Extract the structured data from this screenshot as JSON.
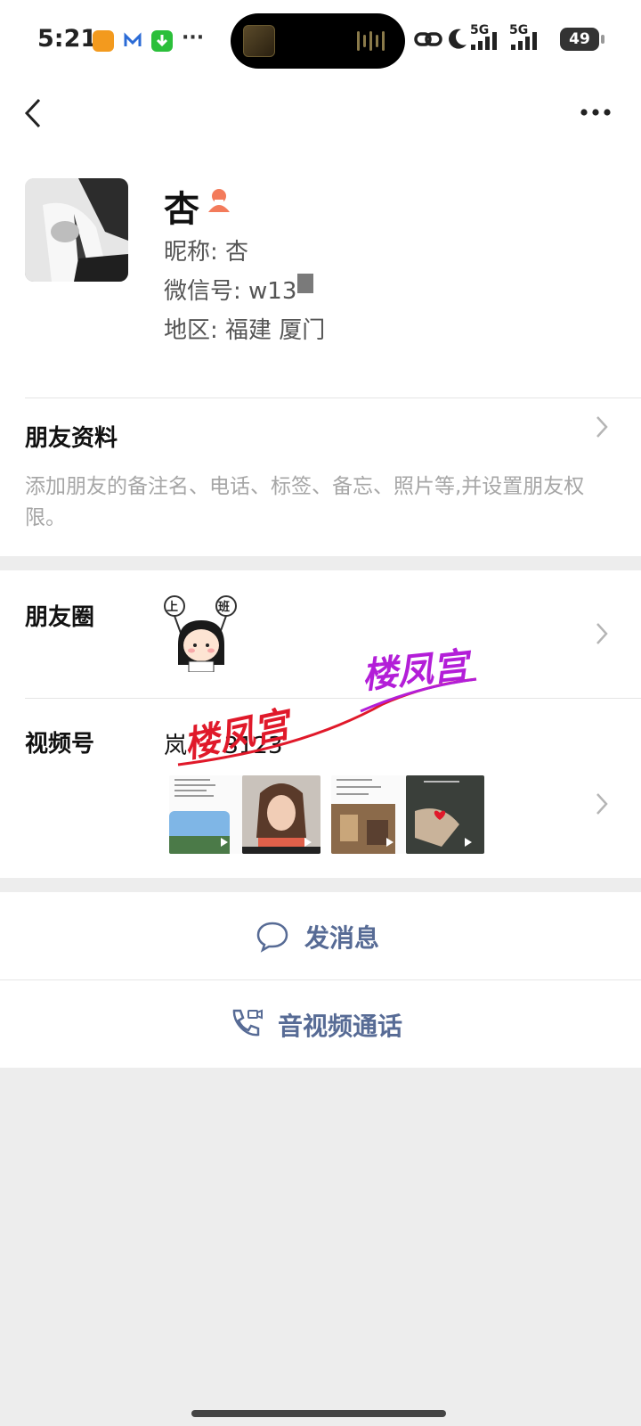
{
  "status_bar": {
    "time": "5:21",
    "network_1": "5G",
    "network_2": "5G",
    "battery": "49"
  },
  "nav": {
    "back_icon": "chevron-left-icon",
    "more_icon": "more-dots-icon"
  },
  "profile": {
    "name": "杏",
    "gender_icon": "female-user-icon",
    "nickname": "昵称: 杏",
    "wechat_id": "微信号: w13",
    "region": "地区: 福建  厦门"
  },
  "friend_info": {
    "title": "朋友资料",
    "description": "添加朋友的备注名、电话、标签、备忘、照片等,并设置朋友权限。"
  },
  "moments": {
    "title": "朋友圈",
    "sticker_left": "上",
    "sticker_right": "班"
  },
  "channels": {
    "title": "视频号",
    "channel_name": "岚     3123"
  },
  "watermark": {
    "text_1": "楼凤宫",
    "text_2": "楼凤宫"
  },
  "actions": {
    "message_label": "发消息",
    "call_label": "音视频通话"
  },
  "colors": {
    "accent": "#576b95",
    "background": "#ededed",
    "watermark_red": "#e0192a",
    "watermark_purple": "#b31ed8"
  }
}
